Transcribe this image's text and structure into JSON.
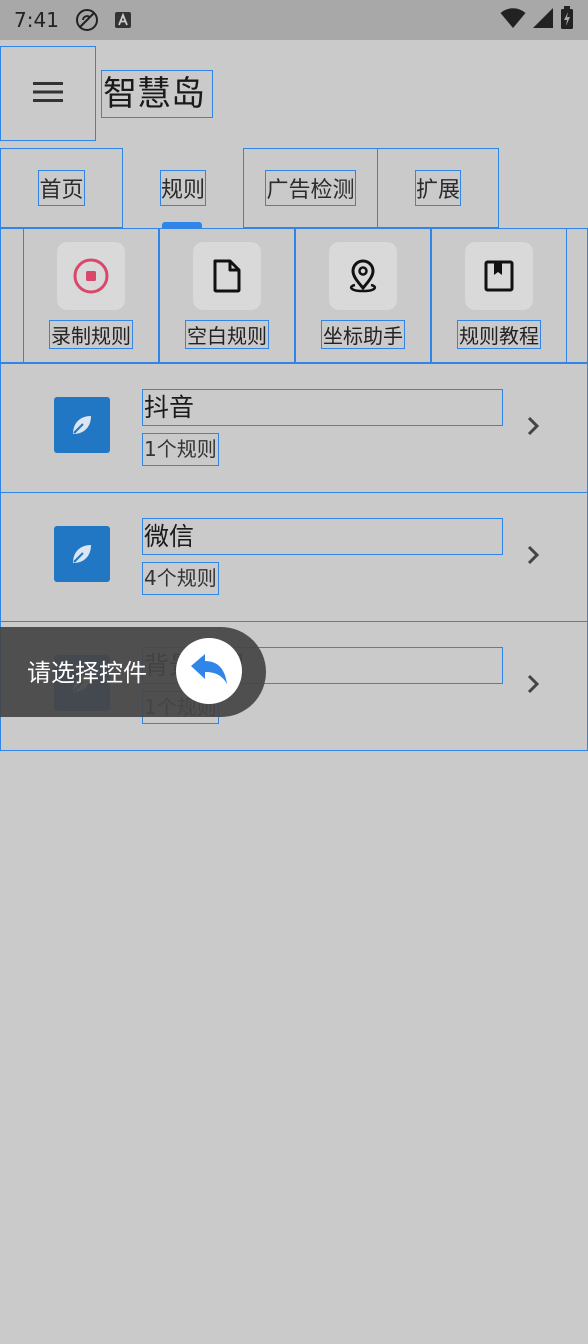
{
  "status_bar": {
    "time": "7:41",
    "icons": [
      "no-sync-icon",
      "a-badge-icon",
      "wifi-icon",
      "signal-icon",
      "battery-icon"
    ]
  },
  "app_bar": {
    "title": "智慧岛",
    "menu_icon": "menu-icon"
  },
  "tabs": [
    {
      "label": "首页"
    },
    {
      "label": "规则"
    },
    {
      "label": "广告检测"
    },
    {
      "label": "扩展"
    }
  ],
  "active_tab": "规则",
  "tools": [
    {
      "label": "录制规则",
      "icon": "record-icon",
      "color": "#e04a6a"
    },
    {
      "label": "空白规则",
      "icon": "blank-document-icon"
    },
    {
      "label": "坐标助手",
      "icon": "location-pin-icon"
    },
    {
      "label": "规则教程",
      "icon": "bookmark-book-icon"
    }
  ],
  "apps": [
    {
      "name": "抖音",
      "count": "1个规则"
    },
    {
      "name": "微信",
      "count": "4个规则"
    },
    {
      "name": "背景管理",
      "count": "1个规则"
    }
  ],
  "toast": {
    "text": "请选择控件",
    "icon": "reply-arrow-icon"
  },
  "colors": {
    "accent": "#2f86e8",
    "app_icon_bg": "#2277c4",
    "status_bar_bg": "#a8a8a8",
    "page_bg": "#cacaca"
  }
}
